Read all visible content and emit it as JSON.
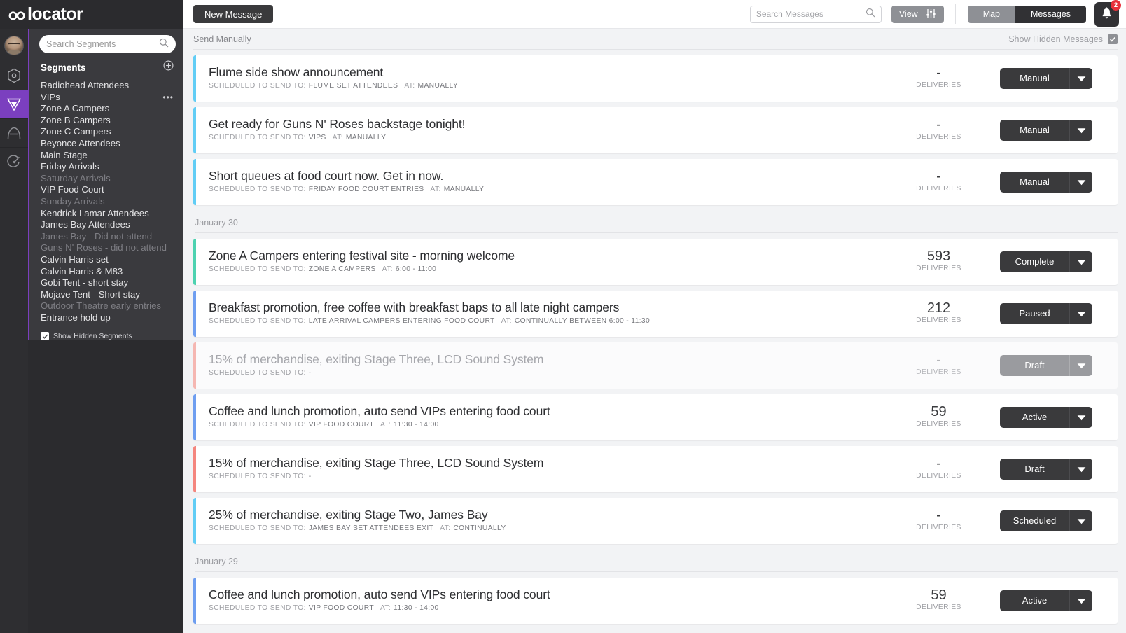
{
  "brand": {
    "logo": "colocator"
  },
  "rail": {
    "items": [
      {
        "name": "hexagon-icon",
        "active": false
      },
      {
        "name": "funnel-icon",
        "active": true
      },
      {
        "name": "arch-icon",
        "active": false
      },
      {
        "name": "compass-icon",
        "active": false
      }
    ]
  },
  "sidebar": {
    "search_placeholder": "Search Segments",
    "search_value": "",
    "title": "Segments",
    "add_label": "+",
    "segments": [
      {
        "label": "Radiohead Attendees",
        "hidden": false,
        "menu": false
      },
      {
        "label": "VIPs",
        "hidden": false,
        "menu": true
      },
      {
        "label": "Zone A Campers",
        "hidden": false,
        "menu": false
      },
      {
        "label": "Zone B Campers",
        "hidden": false,
        "menu": false
      },
      {
        "label": "Zone C Campers",
        "hidden": false,
        "menu": false
      },
      {
        "label": "Beyonce Attendees",
        "hidden": false,
        "menu": false
      },
      {
        "label": "Main Stage",
        "hidden": false,
        "menu": false
      },
      {
        "label": "Friday Arrivals",
        "hidden": false,
        "menu": false
      },
      {
        "label": "Saturday Arrivals",
        "hidden": true,
        "menu": false
      },
      {
        "label": "VIP Food Court",
        "hidden": false,
        "menu": false
      },
      {
        "label": "Sunday Arrivals",
        "hidden": true,
        "menu": false
      },
      {
        "label": "Kendrick Lamar Attendees",
        "hidden": false,
        "menu": false
      },
      {
        "label": "James Bay Attendees",
        "hidden": false,
        "menu": false
      },
      {
        "label": "James Bay - Did not attend",
        "hidden": true,
        "menu": false
      },
      {
        "label": "Guns N' Roses - did not attend",
        "hidden": true,
        "menu": false
      },
      {
        "label": "Calvin Harris set",
        "hidden": false,
        "menu": false
      },
      {
        "label": "Calvin Harris & M83",
        "hidden": false,
        "menu": false
      },
      {
        "label": "Gobi Tent - short stay",
        "hidden": false,
        "menu": false
      },
      {
        "label": "Mojave Tent - Short stay",
        "hidden": false,
        "menu": false
      },
      {
        "label": "Outdoor Theatre early entries",
        "hidden": true,
        "menu": false
      },
      {
        "label": "Entrance hold up",
        "hidden": false,
        "menu": false
      }
    ],
    "show_hidden_label": "Show Hidden Segments",
    "show_hidden_checked": true
  },
  "topbar": {
    "new_message_label": "New Message",
    "search_placeholder": "Search Messages",
    "search_value": "",
    "view_label": "View",
    "toggle": {
      "map_label": "Map",
      "messages_label": "Messages",
      "selected": "Messages"
    },
    "notification_count": "2"
  },
  "subbar": {
    "section_label": "Send Manually",
    "show_hidden_messages_label": "Show Hidden Messages",
    "show_hidden_messages_checked": true
  },
  "colors": {
    "accent_scheduled": "#61cdf5",
    "accent_complete": "#4dd2b0",
    "accent_active": "#6e9ef0",
    "accent_draft": "#f4867f",
    "accent_draft_dim": "#f5b7b2",
    "brand_purple": "#7b3fbf",
    "badge_red": "#e8313c"
  },
  "labels": {
    "scheduled_to": "SCHEDULED TO SEND TO:",
    "at": "AT:",
    "deliveries": "DELIVERIES"
  },
  "messages": [
    {
      "title": "Flume side show announcement",
      "segment": "FLUME SET ATTENDEES",
      "at": "MANUALLY",
      "deliveries": "-",
      "status": "Manual",
      "accent": "#61cdf5",
      "dim": false
    },
    {
      "title": "Get ready for Guns N' Roses backstage tonight!",
      "segment": "VIPS",
      "at": "MANUALLY",
      "deliveries": "-",
      "status": "Manual",
      "accent": "#61cdf5",
      "dim": false
    },
    {
      "title": "Short queues at food court now. Get in now.",
      "segment": "FRIDAY FOOD COURT ENTRIES",
      "at": "MANUALLY",
      "deliveries": "-",
      "status": "Manual",
      "accent": "#61cdf5",
      "dim": false
    }
  ],
  "groups": [
    {
      "date": "January 30",
      "messages": [
        {
          "title": "Zone A Campers entering festival site - morning welcome",
          "segment": "ZONE A CAMPERS",
          "at": "6:00 - 11:00",
          "deliveries": "593",
          "status": "Complete",
          "accent": "#4dd2b0",
          "dim": false
        },
        {
          "title": "Breakfast promotion, free coffee with breakfast baps to all late night campers",
          "segment": "LATE ARRIVAL CAMPERS ENTERING FOOD COURT",
          "at": "CONTINUALLY BETWEEN 6:00 - 11:30",
          "deliveries": "212",
          "status": "Paused",
          "accent": "#6e9ef0",
          "dim": false
        },
        {
          "title": "15% of merchandise, exiting Stage Three, LCD Sound System",
          "segment": "-",
          "at": "",
          "deliveries": "-",
          "status": "Draft",
          "accent": "#f5b7b2",
          "dim": true
        },
        {
          "title": "Coffee and lunch promotion, auto send VIPs entering food court",
          "segment": "VIP FOOD COURT",
          "at": "11:30 - 14:00",
          "deliveries": "59",
          "status": "Active",
          "accent": "#6e9ef0",
          "dim": false
        },
        {
          "title": "15% of merchandise, exiting Stage Three, LCD Sound System",
          "segment": "-",
          "at": "",
          "deliveries": "-",
          "status": "Draft",
          "accent": "#f4867f",
          "dim": false
        },
        {
          "title": "25% of merchandise, exiting Stage Two, James Bay",
          "segment": "JAMES BAY SET ATTENDEES EXIT",
          "at": "CONTINUALLY",
          "deliveries": "-",
          "status": "Scheduled",
          "accent": "#61cdf5",
          "dim": false
        }
      ]
    },
    {
      "date": "January 29",
      "messages": [
        {
          "title": "Coffee and lunch promotion, auto send VIPs entering food court",
          "segment": "VIP FOOD COURT",
          "at": "11:30 - 14:00",
          "deliveries": "59",
          "status": "Active",
          "accent": "#6e9ef0",
          "dim": false
        }
      ]
    }
  ]
}
